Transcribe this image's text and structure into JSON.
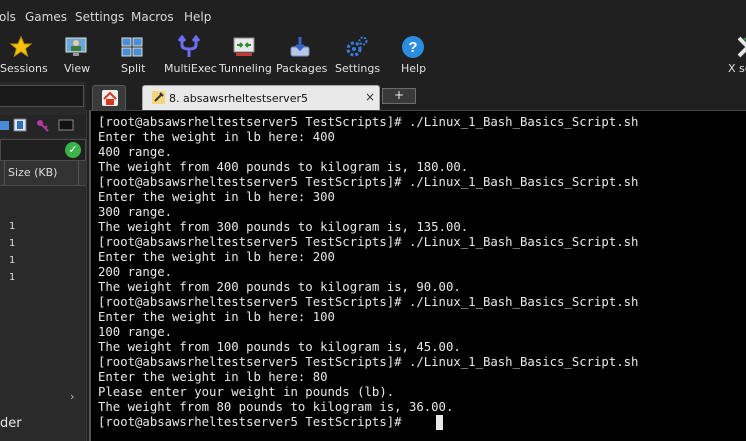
{
  "menu": [
    "ols",
    "Games",
    "Settings",
    "Macros",
    "Help"
  ],
  "toolbar": [
    {
      "label": "Sessions",
      "icon": "star-icon"
    },
    {
      "label": "View",
      "icon": "monitor-user-icon"
    },
    {
      "label": "Split",
      "icon": "split-windows-icon"
    },
    {
      "label": "MultiExec",
      "icon": "fork-icon"
    },
    {
      "label": "Tunneling",
      "icon": "tunnel-icon"
    },
    {
      "label": "Packages",
      "icon": "package-icon"
    },
    {
      "label": "Settings",
      "icon": "gears-icon"
    },
    {
      "label": "Help",
      "icon": "help-icon"
    },
    {
      "label": "X se",
      "icon": "x-server-icon"
    }
  ],
  "sidebar": {
    "size_header": "Size (KB)",
    "sizes": [
      "1",
      "1",
      "1",
      "1"
    ],
    "bottom_text": "der"
  },
  "tabs": {
    "session_title": "8. absawsrheltestserver5",
    "new_tab": "+",
    "close": "×"
  },
  "terminal": {
    "lines": [
      "[root@absawsrheltestserver5 TestScripts]# ./Linux_1_Bash_Basics_Script.sh",
      "Enter the weight in lb here: 400",
      "400 range.",
      "The weight from 400 pounds to kilogram is, 180.00.",
      "[root@absawsrheltestserver5 TestScripts]# ./Linux_1_Bash_Basics_Script.sh",
      "Enter the weight in lb here: 300",
      "300 range.",
      "The weight from 300 pounds to kilogram is, 135.00.",
      "[root@absawsrheltestserver5 TestScripts]# ./Linux_1_Bash_Basics_Script.sh",
      "Enter the weight in lb here: 200",
      "200 range.",
      "The weight from 200 pounds to kilogram is, 90.00.",
      "[root@absawsrheltestserver5 TestScripts]# ./Linux_1_Bash_Basics_Script.sh",
      "Enter the weight in lb here: 100",
      "100 range.",
      "The weight from 100 pounds to kilogram is, 45.00.",
      "[root@absawsrheltestserver5 TestScripts]# ./Linux_1_Bash_Basics_Script.sh",
      "Enter the weight in lb here: 80",
      "Please enter your weight in pounds (lb).",
      "The weight from 80 pounds to kilogram is, 36.00.",
      "[root@absawsrheltestserver5 TestScripts]# "
    ]
  }
}
